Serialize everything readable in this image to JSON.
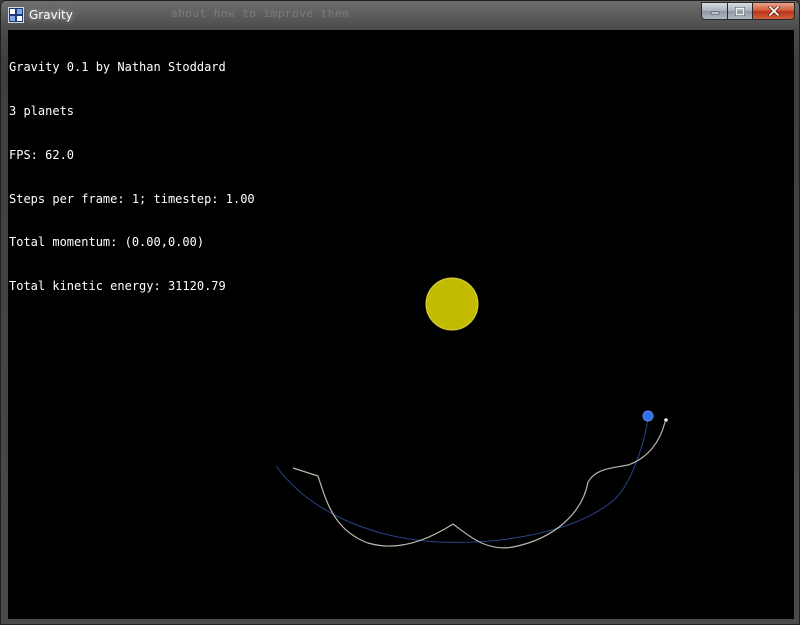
{
  "window": {
    "title": "Gravity",
    "ghost_text": "                    about how to improve them"
  },
  "hud": {
    "line1": "Gravity 0.1 by Nathan Stoddard",
    "line2": "3 planets",
    "line3": "FPS: 62.0",
    "line4": "Steps per frame: 1; timestep: 1.00",
    "line5": "Total momentum: (0.00,0.00)",
    "line6": "Total kinetic energy: 31120.79"
  },
  "colors": {
    "sun": "#c2bb00",
    "sun_edge": "#d9d24a",
    "blue_planet": "#2f6fe8",
    "blue_trail": "#2c4a9a",
    "white_trail": "#d8d8c8",
    "background": "#000000"
  },
  "icons": {
    "app": "app-icon",
    "minimize": "minimize-icon",
    "maximize": "maximize-icon",
    "close": "close-icon"
  }
}
